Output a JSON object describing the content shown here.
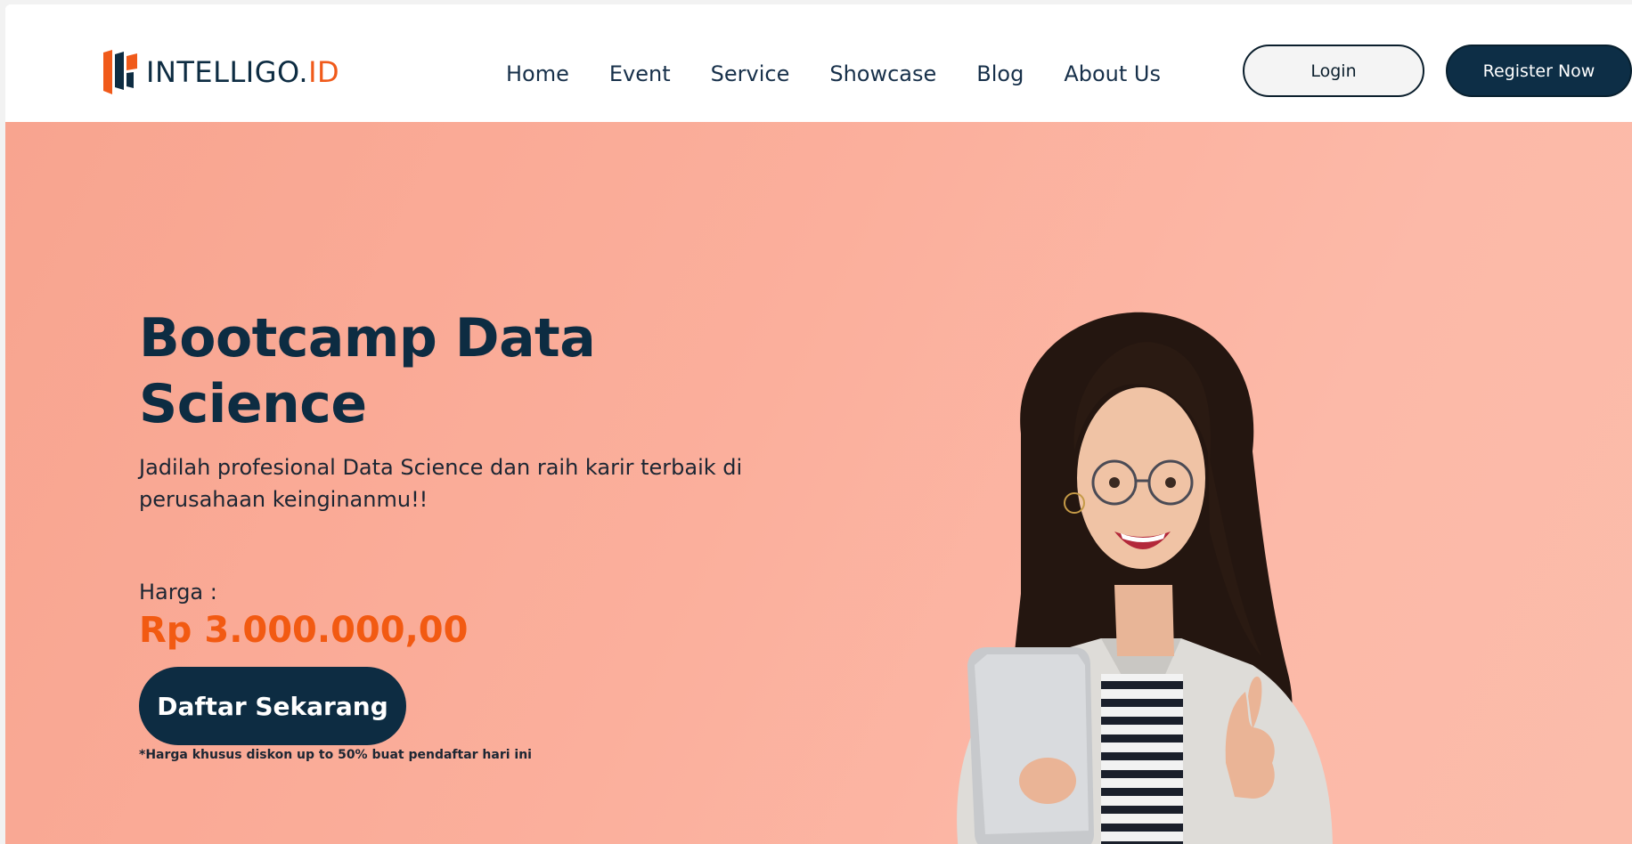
{
  "brand": {
    "name_main": "INTELLIGO.",
    "name_accent": "ID",
    "colors": {
      "primary": "#0d2c42",
      "accent": "#f05a1a",
      "hero_bg": "#f9a892"
    }
  },
  "nav": {
    "items": [
      {
        "label": "Home"
      },
      {
        "label": "Event"
      },
      {
        "label": "Service"
      },
      {
        "label": "Showcase"
      },
      {
        "label": "Blog"
      },
      {
        "label": "About Us"
      }
    ]
  },
  "auth": {
    "login_label": "Login",
    "register_label": "Register Now"
  },
  "hero": {
    "title_line1": "Bootcamp Data",
    "title_line2": "Science",
    "subtitle": "Jadilah profesional Data Science dan raih karir terbaik di perusahaan keinginanmu!!",
    "price_label": "Harga :",
    "price_value": "Rp 3.000.000,00",
    "cta_label": "Daftar Sekarang",
    "note": "*Harga khusus diskon up to 50% buat pendaftar hari ini",
    "image": "smiling-woman-with-laptop-thumbs-up"
  }
}
